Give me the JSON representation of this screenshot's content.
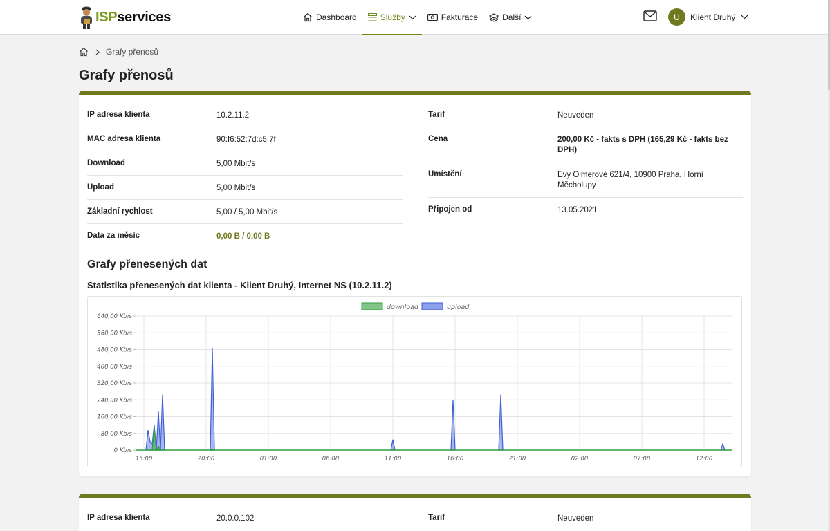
{
  "header": {
    "logo_isp": "ISP",
    "logo_services": "services",
    "nav": [
      {
        "label": "Dashboard",
        "icon": "home-icon"
      },
      {
        "label": "Služby",
        "icon": "list-icon",
        "active": true
      },
      {
        "label": "Fakturace",
        "icon": "invoice-icon"
      },
      {
        "label": "Další",
        "icon": "layers-icon"
      }
    ],
    "user_initial": "U",
    "user_name": "Klient Druhý"
  },
  "breadcrumb": {
    "current": "Grafy přenosů"
  },
  "page_title": "Grafy přenosů",
  "card1": {
    "left": [
      {
        "k": "IP adresa klienta",
        "v": "10.2.11.2"
      },
      {
        "k": "MAC adresa klienta",
        "v": "90:f6:52:7d:c5:7f"
      },
      {
        "k": "Download",
        "v": "5,00 Mbit/s"
      },
      {
        "k": "Upload",
        "v": "5,00 Mbit/s"
      },
      {
        "k": "Základní rychlost",
        "v": "5,00 / 5,00 Mbit/s"
      },
      {
        "k": "Data za měsíc",
        "v": "0,00 B / 0,00 B"
      }
    ],
    "right": [
      {
        "k": "Tarif",
        "v": "Neuveden"
      },
      {
        "k": "Cena",
        "v": "200,00 Kč - fakts s DPH (165,29 Kč - fakts bez DPH)"
      },
      {
        "k": "Umístění",
        "v": "Evy Olmerové 621/4, 10900 Praha, Horní Měcholupy"
      },
      {
        "k": "Připojen od",
        "v": "13.05.2021"
      }
    ],
    "section_title": "Grafy přenesených dat",
    "chart_title": "Statistika přenesených dat klienta - Klient Druhý, Internet NS (10.2.11.2)"
  },
  "card2": {
    "left": [
      {
        "k": "IP adresa klienta",
        "v": "20.0.0.102"
      }
    ],
    "right": [
      {
        "k": "Tarif",
        "v": "Neuveden"
      }
    ]
  },
  "colors": {
    "accent": "#6f7a1e",
    "download": "#2e9e3c",
    "upload": "#3f5fd8"
  },
  "chart_data": {
    "type": "area",
    "title": "",
    "legend_position": "top-center",
    "series": [
      {
        "name": "download",
        "points": [
          [
            "15:40",
            0
          ],
          [
            "15:50",
            110
          ],
          [
            "16:00",
            0
          ],
          [
            "16:10",
            20
          ],
          [
            "16:20",
            0
          ],
          [
            "20:20",
            0
          ],
          [
            "20:30",
            5
          ],
          [
            "20:40",
            0
          ]
        ]
      },
      {
        "name": "upload",
        "points": [
          [
            "15:10",
            0
          ],
          [
            "15:20",
            95
          ],
          [
            "15:30",
            40
          ],
          [
            "15:40",
            30
          ],
          [
            "15:50",
            120
          ],
          [
            "16:00",
            0
          ],
          [
            "16:10",
            185
          ],
          [
            "16:20",
            0
          ],
          [
            "16:30",
            265
          ],
          [
            "16:40",
            0
          ],
          [
            "20:20",
            0
          ],
          [
            "20:30",
            485
          ],
          [
            "20:40",
            0
          ],
          [
            "10:50",
            0
          ],
          [
            "11:00",
            50
          ],
          [
            "11:10",
            0
          ],
          [
            "15:40",
            0
          ],
          [
            "15:50",
            240
          ],
          [
            "16:00",
            0
          ],
          [
            "19:30",
            0
          ],
          [
            "19:40",
            265
          ],
          [
            "19:50",
            0
          ],
          [
            "13:20",
            0
          ],
          [
            "13:30",
            30
          ],
          [
            "13:40",
            0
          ]
        ]
      }
    ],
    "x_ticks": [
      "15:00",
      "20:00",
      "01:00",
      "06:00",
      "11:00",
      "16:00",
      "21:00",
      "02:00",
      "07:00",
      "12:00"
    ],
    "y_ticks": [
      "0 Kb/s",
      "80,00 Kb/s",
      "160,00 Kb/s",
      "240,00 Kb/s",
      "320,00 Kb/s",
      "400,00 Kb/s",
      "480,00 Kb/s",
      "560,00 Kb/s",
      "640,00 Kb/s"
    ],
    "ylim": [
      0,
      640
    ],
    "grid": true
  }
}
